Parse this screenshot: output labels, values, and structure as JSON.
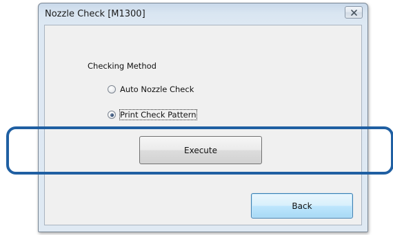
{
  "window": {
    "title": "Nozzle Check [M1300]"
  },
  "group": {
    "label": "Checking Method"
  },
  "options": [
    {
      "label": "Auto Nozzle Check",
      "selected": false
    },
    {
      "label": "Print Check Pattern",
      "selected": true
    }
  ],
  "buttons": {
    "execute_label": "Execute",
    "back_label": "Back"
  },
  "icons": {
    "close": "close-icon"
  },
  "colors": {
    "highlight": "#1f5fa2",
    "default_button_border": "#3c7fb1"
  }
}
